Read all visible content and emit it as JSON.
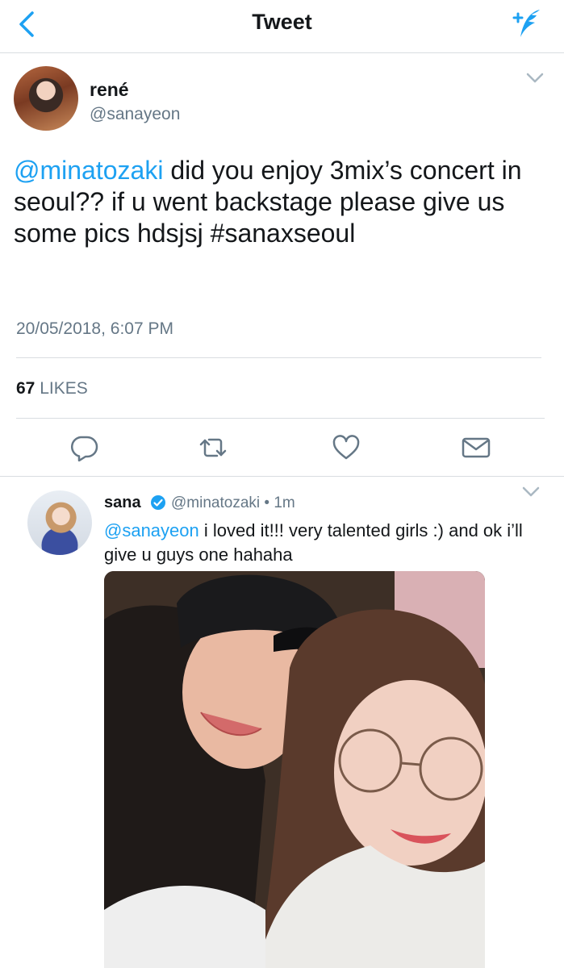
{
  "nav": {
    "title": "Tweet",
    "back_icon": "chevron-left-icon",
    "compose_icon": "compose-tweet-icon",
    "accent": "#1da1f2"
  },
  "tweet": {
    "author_name": "rené",
    "author_handle": "@sanayeon",
    "text_mention": "@minatozaki",
    "text_body": " did you enjoy 3mix’s concert in seoul?? if u went backstage please give us some pics hdsjsj #sanaxseoul",
    "timestamp": "20/05/2018, 6:07 PM",
    "likes_count": "67",
    "likes_label": "LIKES"
  },
  "actions": [
    "reply-icon",
    "retweet-icon",
    "like-icon",
    "share-mail-icon"
  ],
  "reply": {
    "author_name": "sana",
    "author_handle": "@minatozaki",
    "time": "1m",
    "separator": "•",
    "text_mention": "@sanayeon",
    "text_body": " i loved it!!! very talented girls :) and ok i’ll give u guys one hahaha",
    "verified_icon": "verified-badge-icon"
  },
  "colors": {
    "text": "#14171a",
    "secondary": "#657786",
    "link": "#1da1f2",
    "divider": "#d9dde1"
  }
}
